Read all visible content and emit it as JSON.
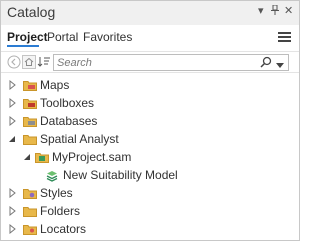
{
  "pane": {
    "title": "Catalog",
    "pin_glyph": "▾",
    "dock_glyph": "⊓",
    "close_glyph": "✕"
  },
  "tabs": [
    {
      "label": "Project",
      "active": true
    },
    {
      "label": "Portal",
      "active": false
    },
    {
      "label": "Favorites",
      "active": false
    }
  ],
  "search": {
    "placeholder": "Search",
    "value": ""
  },
  "tree": {
    "items": [
      {
        "label": "Maps",
        "icon": "maps-folder-icon",
        "expanded": false
      },
      {
        "label": "Toolboxes",
        "icon": "toolboxes-folder-icon",
        "expanded": false
      },
      {
        "label": "Databases",
        "icon": "databases-folder-icon",
        "expanded": false
      },
      {
        "label": "Spatial Analyst",
        "icon": "folder-icon",
        "expanded": true
      },
      {
        "label": "MyProject.sam",
        "icon": "spatial-analyst-project-icon",
        "expanded": true
      },
      {
        "label": "New Suitability Model",
        "icon": "suitability-model-icon",
        "expanded": false
      },
      {
        "label": "Styles",
        "icon": "styles-folder-icon",
        "expanded": false
      },
      {
        "label": "Folders",
        "icon": "folders-folder-icon",
        "expanded": false
      },
      {
        "label": "Locators",
        "icon": "locators-folder-icon",
        "expanded": false
      }
    ]
  },
  "colors": {
    "accent": "#2b7cd3",
    "folder": "#e8b84a",
    "folder_dark": "#c9952a"
  }
}
